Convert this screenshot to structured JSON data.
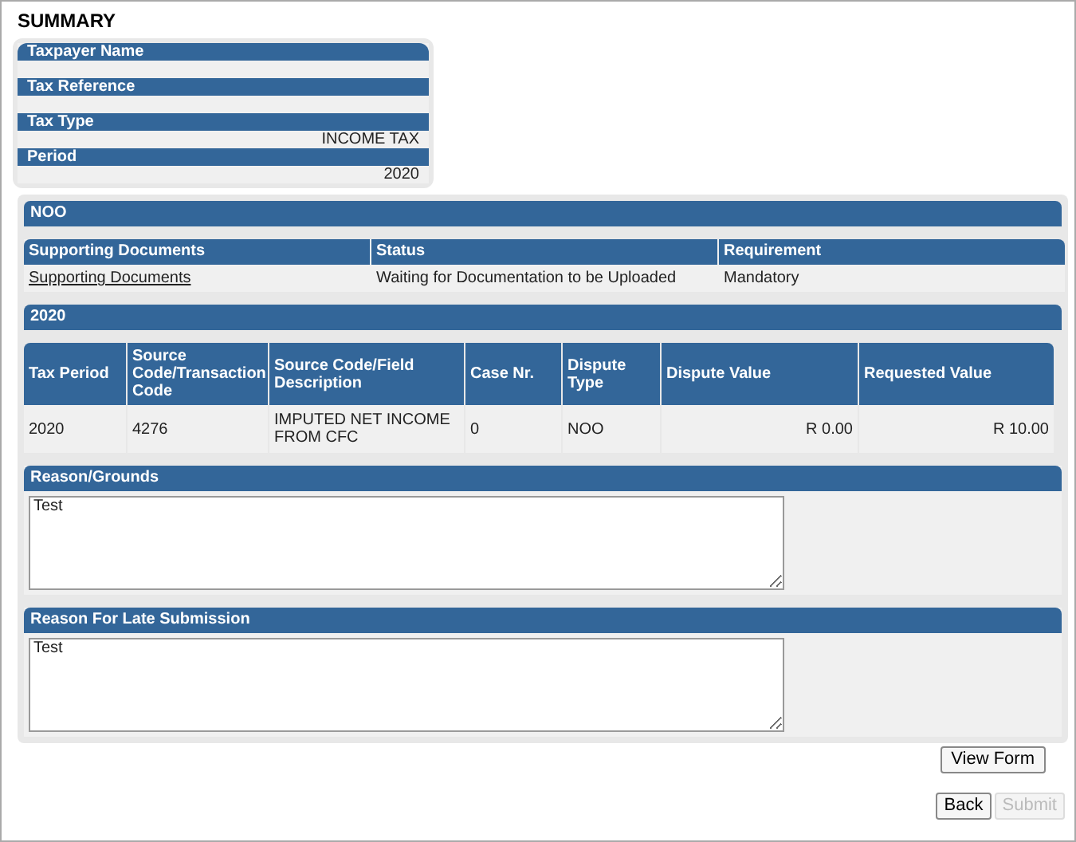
{
  "title": "SUMMARY",
  "summary": [
    {
      "label": "Taxpayer Name"
    },
    {
      "label": "Tax Reference"
    },
    {
      "label": "Tax Type",
      "value": "INCOME TAX"
    },
    {
      "label": "Period",
      "value": "2020"
    }
  ],
  "section_header": "NOO",
  "documents": {
    "columns": [
      "Supporting Documents",
      "Status",
      "Requirement"
    ],
    "rows": [
      [
        {
          "kind": "link",
          "text": "Supporting Documents"
        },
        {
          "kind": "text",
          "text": "Waiting for Documentation to be Uploaded"
        },
        {
          "kind": "text",
          "text": "Mandatory"
        }
      ]
    ]
  },
  "period_header": "2020",
  "disputes": {
    "columns": [
      "Tax Period",
      "Source Code/Transaction Code",
      "Source Code/Field Description",
      "Case Nr.",
      "Dispute Type",
      "Dispute Value",
      "Requested Value"
    ],
    "rows": [
      [
        {
          "kind": "text",
          "text": "2020"
        },
        {
          "kind": "text",
          "text": "4276"
        },
        {
          "kind": "text",
          "text": "IMPUTED NET INCOME FROM CFC"
        },
        {
          "kind": "text",
          "text": "0"
        },
        {
          "kind": "text",
          "text": "NOO"
        },
        {
          "kind": "amount",
          "text": "R 0.00"
        },
        {
          "kind": "amount",
          "text": "R 10.00"
        }
      ]
    ]
  },
  "text_sections": [
    {
      "label": "Reason/Grounds",
      "value": "Test"
    },
    {
      "label": "Reason For Late Submission",
      "value": "Test"
    }
  ],
  "view_form_button": {
    "label": "View Form",
    "disabled": false
  },
  "buttons": [
    {
      "label": "Back",
      "disabled": false
    },
    {
      "label": "Submit",
      "disabled": true
    }
  ]
}
